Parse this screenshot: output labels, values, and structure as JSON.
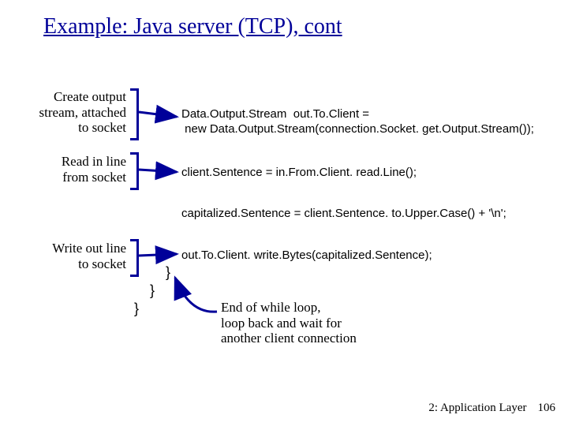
{
  "title": "Example: Java server (TCP), cont",
  "annotations": {
    "create_output": "Create output\nstream, attached\nto socket",
    "read_line": "Read in  line\nfrom socket",
    "write_line": "Write out line\nto socket",
    "end_loop": "End of while loop,\nloop back and wait for\nanother client connection"
  },
  "code": {
    "data_output_1": "Data.Output.Stream  out.To.Client =",
    "data_output_2": " new Data.Output.Stream(connection.Socket. get.Output.Stream());",
    "client_sentence": "client.Sentence = in.From.Client. read.Line();",
    "capitalized": "capitalized.Sentence = client.Sentence. to.Upper.Case() + '\\n';",
    "write_bytes": "out.To.Client. write.Bytes(capitalized.Sentence);",
    "brace_inner": "}",
    "brace_mid": "}",
    "brace_outer": "}"
  },
  "footer": {
    "chapter": "2: Application Layer",
    "page": "106"
  }
}
